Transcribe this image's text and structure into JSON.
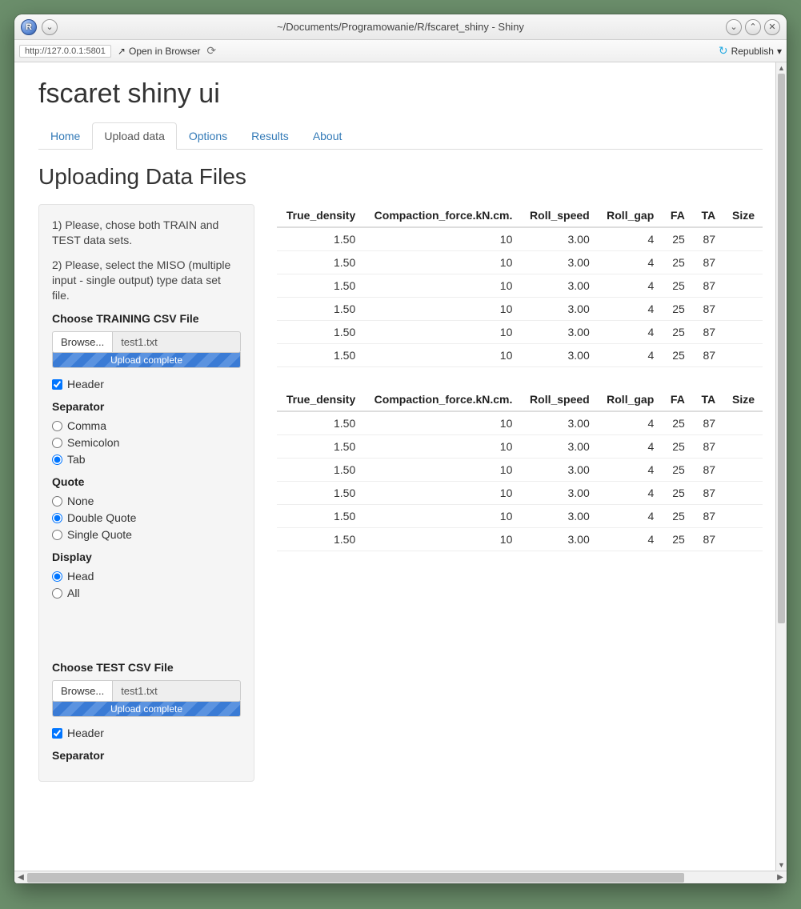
{
  "window": {
    "title": "~/Documents/Programowanie/R/fscaret_shiny - Shiny",
    "app_badge": "R"
  },
  "toolbar": {
    "url": "http://127.0.0.1:5801",
    "open_browser": "Open in Browser",
    "republish": "Republish"
  },
  "app": {
    "title": "fscaret shiny ui",
    "tabs": [
      "Home",
      "Upload data",
      "Options",
      "Results",
      "About"
    ],
    "active_tab_index": 1,
    "section_title": "Uploading Data Files"
  },
  "sidebar": {
    "note1": "1) Please, chose both TRAIN and TEST data sets.",
    "note2": "2) Please, select the MISO (multiple input - single output) type data set file.",
    "train_label": "Choose TRAINING CSV File",
    "test_label": "Choose TEST CSV File",
    "browse": "Browse...",
    "train_file": "test1.txt",
    "test_file": "test1.txt",
    "upload_msg": "Upload complete",
    "header_label": "Header",
    "header_checked": true,
    "separator_label": "Separator",
    "sep_options": [
      "Comma",
      "Semicolon",
      "Tab"
    ],
    "sep_selected": 2,
    "quote_label": "Quote",
    "quote_options": [
      "None",
      "Double Quote",
      "Single Quote"
    ],
    "quote_selected": 1,
    "display_label": "Display",
    "display_options": [
      "Head",
      "All"
    ],
    "display_selected": 0,
    "header2_label": "Header",
    "header2_checked": true,
    "separator2_label": "Separator"
  },
  "table": {
    "headers": [
      "True_density",
      "Compaction_force.kN.cm.",
      "Roll_speed",
      "Roll_gap",
      "FA",
      "TA",
      "Size"
    ],
    "rows": [
      [
        "1.50",
        "10",
        "3.00",
        "4",
        "25",
        "87",
        ""
      ],
      [
        "1.50",
        "10",
        "3.00",
        "4",
        "25",
        "87",
        ""
      ],
      [
        "1.50",
        "10",
        "3.00",
        "4",
        "25",
        "87",
        ""
      ],
      [
        "1.50",
        "10",
        "3.00",
        "4",
        "25",
        "87",
        ""
      ],
      [
        "1.50",
        "10",
        "3.00",
        "4",
        "25",
        "87",
        ""
      ],
      [
        "1.50",
        "10",
        "3.00",
        "4",
        "25",
        "87",
        ""
      ]
    ]
  }
}
